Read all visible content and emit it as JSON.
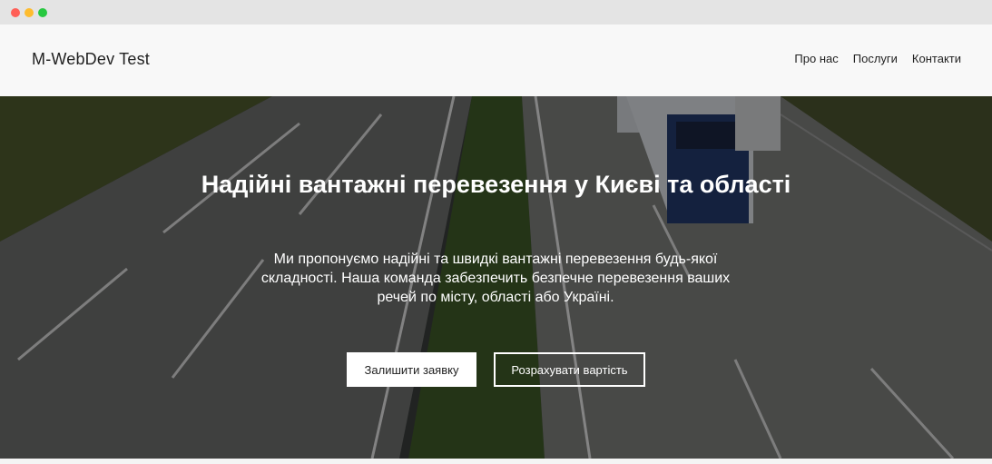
{
  "window": {
    "controls": [
      "close",
      "minimize",
      "maximize"
    ]
  },
  "header": {
    "brand": "M-WebDev Test",
    "nav": [
      {
        "label": "Про нас"
      },
      {
        "label": "Послуги"
      },
      {
        "label": "Контакти"
      }
    ]
  },
  "hero": {
    "title": "Надійні вантажні перевезення у Києві та області",
    "text": "Ми пропонуємо надійні та швидкі вантажні перевезення будь-якої складності. Наша команда забезпечить безпечне перевезення ваших речей по місту, області або Україні.",
    "primary_button": "Залишити заявку",
    "secondary_button": "Розрахувати вартість",
    "background": "highway-with-trucks-photo"
  },
  "colors": {
    "header_bg": "#f8f8f8",
    "hero_text": "#ffffff",
    "button_bg": "#ffffff"
  }
}
